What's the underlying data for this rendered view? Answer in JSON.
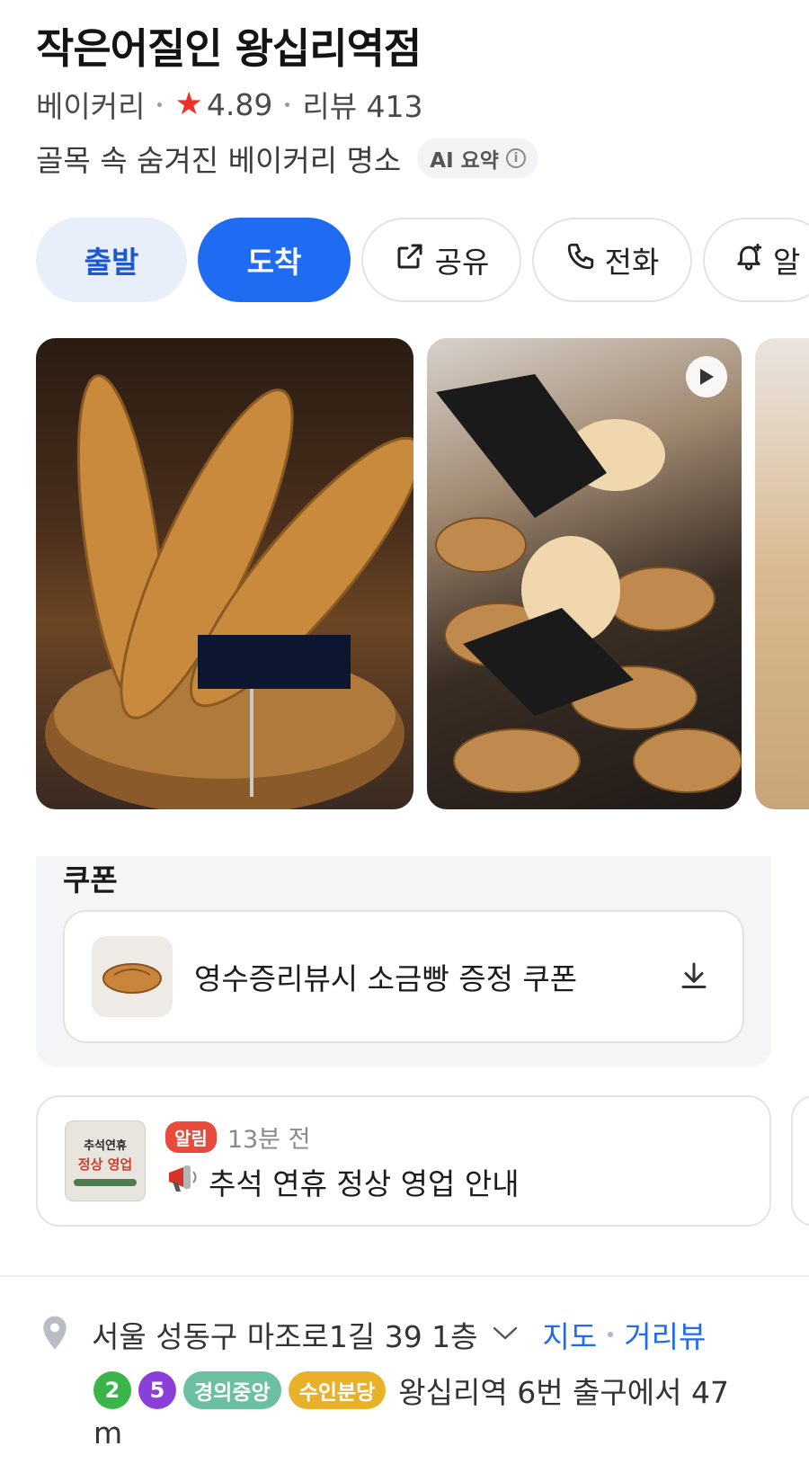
{
  "place": {
    "name": "작은어질인 왕십리역점",
    "category": "베이커리",
    "rating": "4.89",
    "reviews": "리뷰 413",
    "description": "골목 속 숨겨진 베이커리 명소",
    "ai_summary_label": "AI 요약"
  },
  "actions": {
    "start": "출발",
    "arrive": "도착",
    "share": "공유",
    "call": "전화",
    "alarm": "알"
  },
  "coupon": {
    "section_title": "쿠폰",
    "text": "영수증리뷰시 소금빵 증정 쿠폰"
  },
  "notice": {
    "badge": "알림",
    "time": "13분 전",
    "title": "추석 연휴 정상 영업 안내",
    "thumb_line1": "추석연휴",
    "thumb_line2": "정상 영업"
  },
  "address": {
    "text": "서울 성동구 마조로1길 39 1층",
    "map_link": "지도",
    "street_link": "거리뷰"
  },
  "transit": {
    "lines": [
      {
        "label": "2",
        "color": "#3bb54a"
      },
      {
        "label": "5",
        "color": "#8a3fd8"
      },
      {
        "label": "경의중앙",
        "color": "#6cc0a2"
      },
      {
        "label": "수인분당",
        "color": "#e9b12a"
      }
    ],
    "text": "왕십리역 6번 출구에서 47",
    "text_wrap": "m"
  },
  "colors": {
    "accent": "#1f6bf2",
    "star": "#f0302a",
    "alert": "#e84a3c"
  }
}
